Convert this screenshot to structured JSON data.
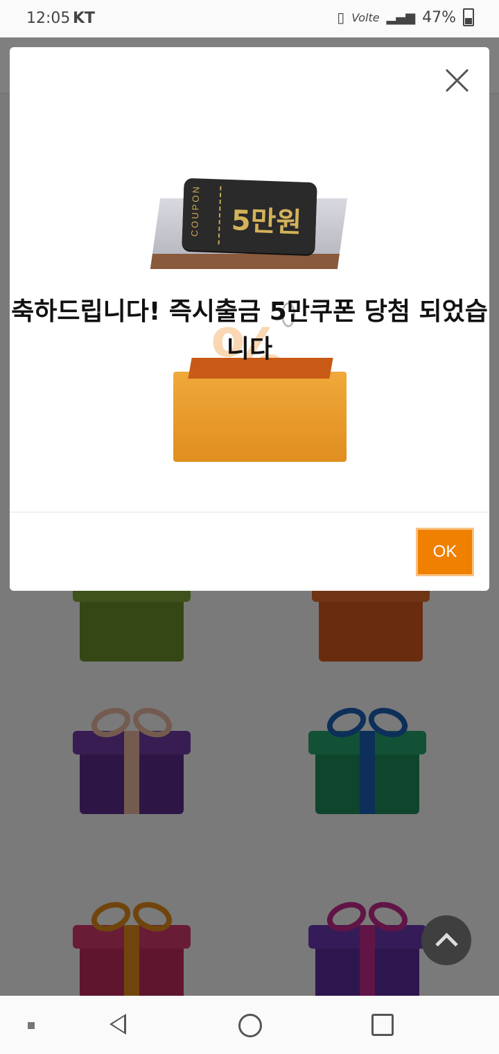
{
  "status_bar": {
    "time": "12:05",
    "carrier": "KT",
    "network": "Volte",
    "battery": "47%"
  },
  "modal": {
    "coupon_side_text": "COUPON",
    "coupon_amount": "5만원",
    "message": "축하드립니다! 즉시출금 5만쿠폰 당첨 되었습니다",
    "ok_label": "OK"
  },
  "background_gifts": [
    {
      "color": "#6a8f2a"
    },
    {
      "color": "#d4581f"
    },
    {
      "color": "#5b2d8a",
      "bow": "#e8b7a0"
    },
    {
      "color": "#1e8a5a",
      "bow": "#1a5fb4"
    },
    {
      "color": "#c02a5c",
      "bow": "#e08a1a"
    },
    {
      "color": "#5b2d9a",
      "bow": "#c02a8c"
    }
  ],
  "colors": {
    "accent": "#f08000",
    "overlay": "rgba(0,0,0,0.5)"
  },
  "icons": {
    "close": "close-icon",
    "scroll_top": "chevron-up-icon",
    "nav_back": "back-icon",
    "nav_home": "home-icon",
    "nav_recent": "recent-apps-icon"
  }
}
